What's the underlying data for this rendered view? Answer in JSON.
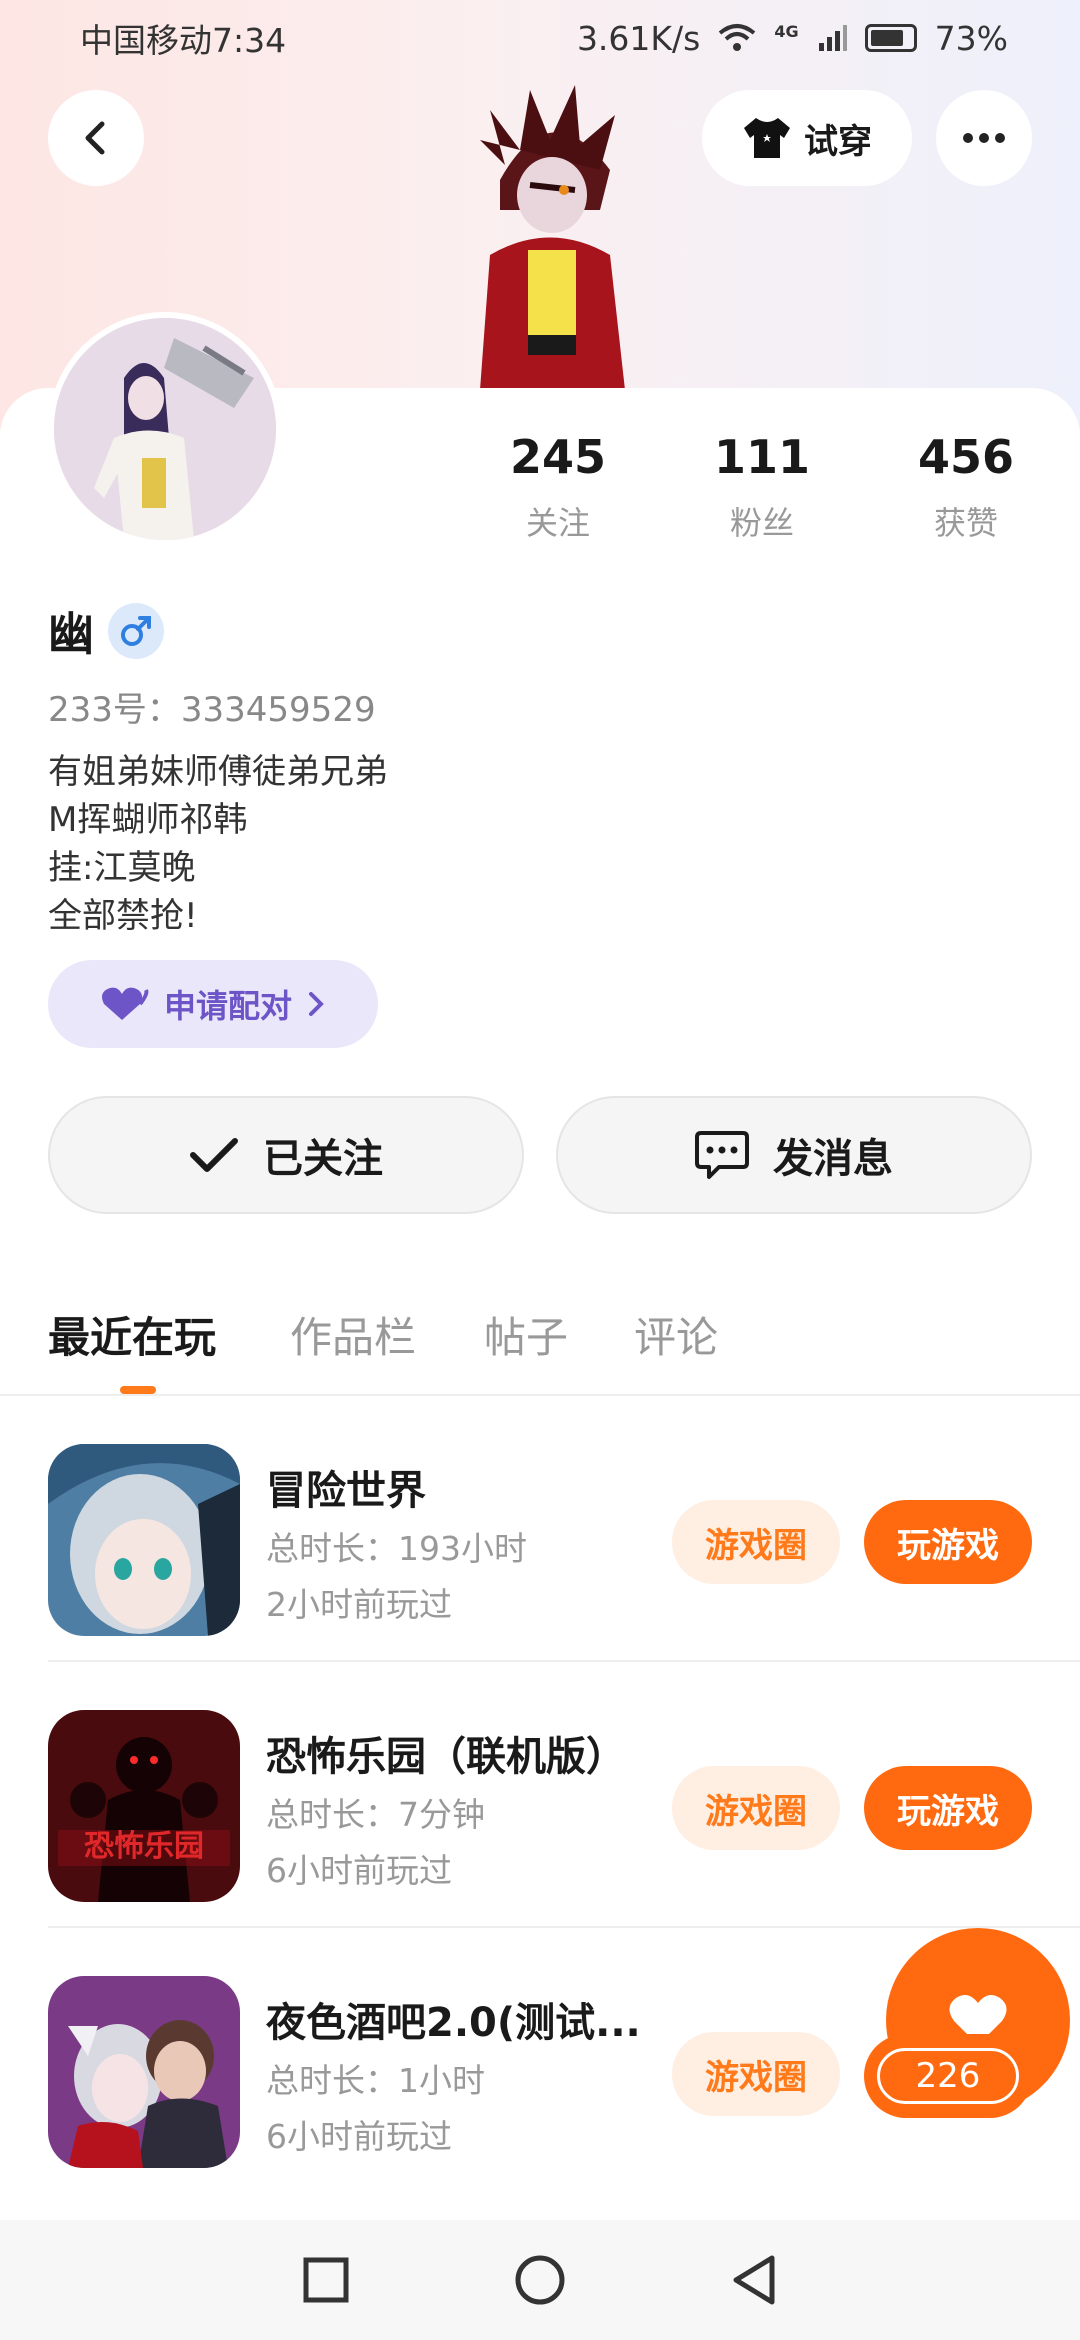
{
  "status_bar": {
    "carrier_time": "中国移动7:34",
    "network_speed": "3.61K/s",
    "network_type": "4G",
    "battery": "73%"
  },
  "header": {
    "try_on_label": "试穿"
  },
  "profile": {
    "stats": [
      {
        "value": "245",
        "label": "关注"
      },
      {
        "value": "111",
        "label": "粉丝"
      },
      {
        "value": "456",
        "label": "获赞"
      }
    ],
    "name": "幽",
    "gender": "male",
    "uid": "233号：333459529",
    "bio_lines": [
      "有姐弟妹师傅徒弟兄弟",
      "M挥蝴师祁韩",
      "挂:江莫晚",
      "全部禁抢!"
    ],
    "match_label": "申请配对"
  },
  "actions": {
    "followed_label": "已关注",
    "message_label": "发消息"
  },
  "tabs": [
    "最近在玩",
    "作品栏",
    "帖子",
    "评论"
  ],
  "games": [
    {
      "title": "冒险世界",
      "duration": "总时长：193小时",
      "last_played": "2小时前玩过",
      "circle_label": "游戏圈",
      "play_label": "玩游戏"
    },
    {
      "title": "恐怖乐园（联机版）",
      "duration": "总时长：7分钟",
      "last_played": "6小时前玩过",
      "circle_label": "游戏圈",
      "play_label": "玩游戏"
    },
    {
      "title": "夜色酒吧2.0(测试...",
      "duration": "总时长：1小时",
      "last_played": "6小时前玩过",
      "circle_label": "游戏圈"
    }
  ],
  "like": {
    "count": "226"
  },
  "colors": {
    "accent": "#ff6a10",
    "accent_light": "#ffeee2",
    "match_purple": "#6d55c8"
  }
}
